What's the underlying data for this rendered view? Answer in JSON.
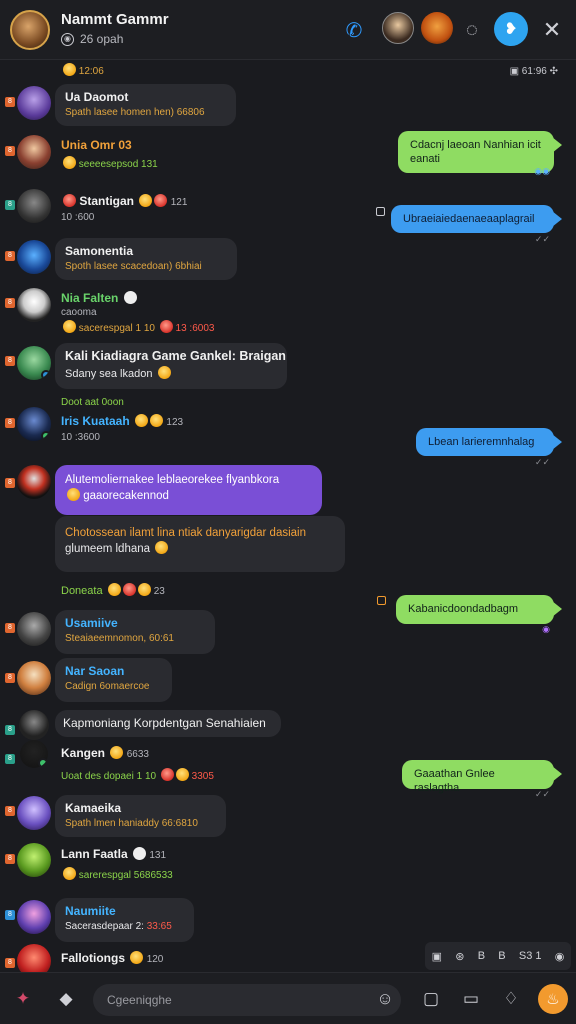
{
  "header": {
    "title": "Nammt Gammr",
    "subtitle": "26 opah"
  },
  "top": {
    "left_time": "12:06",
    "right_info": "61:96"
  },
  "messages_left": [
    {
      "name": "Ua Daomot",
      "sub": "Spath lasee homen hen) 66806"
    },
    {
      "name": "Unia Omr 03",
      "sub": "seeeesepsod 131"
    },
    {
      "name": "Stantigan",
      "count": "121",
      "meta": "10 :600"
    },
    {
      "name": "Samonentia",
      "sub": "Spoth lasee scacedoan) 6bhiai"
    },
    {
      "name": "Nia Falten",
      "meta": "caooma",
      "meta2": "sacerespgal 1 10",
      "meta2_red": "13 :6003"
    },
    {
      "name": "Kali Kiadiagra Game Gankel: Braigan",
      "sub": "Sdany sea lkadon"
    },
    {
      "name": "Iris Kuataah",
      "count": "123",
      "meta": "10 :3600"
    },
    {
      "purple": "Alutemoliernakee leblaeorekee flyanbkora",
      "purple2": "gaaorecakennod"
    },
    {
      "dark": "Chotossean ilamt lina ntiak danyarigdar dasiain",
      "dark2": "glumeem ldhana"
    },
    {
      "name": "Doneata",
      "count": "23"
    },
    {
      "name": "Usamiive",
      "sub": "Steaiaeemnomon, 60:61"
    },
    {
      "name": "Nar Saoan",
      "sub": "Cadign 6omaercoe"
    },
    {
      "name": "Kapmoniang Korpdentgan Senahiaien"
    },
    {
      "name": "Kangen",
      "count": "6633",
      "meta": "Uoat des dopaei 1 10",
      "meta_red": "3305"
    },
    {
      "name": "Kamaeika",
      "sub": "Spath lmen haniaddy 66:6810"
    },
    {
      "name": "Lann Faatla",
      "count": "131",
      "meta": "sarerespgal 5686533"
    },
    {
      "name": "Naumiite",
      "sub": "Sacerasdepaar 2:",
      "sub_red": "33:65"
    },
    {
      "name": "Fallotiongs",
      "count": "120"
    }
  ],
  "messages_right": [
    {
      "text": "Cdacnj laeoan Nanhian icit",
      "text2": "eanati",
      "color": "green"
    },
    {
      "text": "Ubraeiaiedaenaeaaplagrail",
      "color": "blue"
    },
    {
      "text": "Lbean larieremnhalag",
      "color": "blue"
    },
    {
      "text": "Kabanicdoondadbagm",
      "color": "green"
    },
    {
      "text": "Gaaathan Gnlee raslagtha",
      "color": "green"
    }
  ],
  "float_bar": {
    "a": "B",
    "b": "B",
    "c": "S",
    "d": "S3 1"
  },
  "composer": {
    "placeholder": "Cgeeniqghe"
  }
}
